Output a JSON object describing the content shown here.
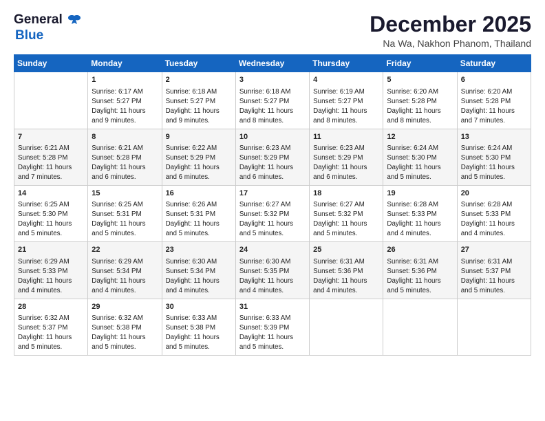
{
  "logo": {
    "line1": "General",
    "line2": "Blue"
  },
  "title": "December 2025",
  "subtitle": "Na Wa, Nakhon Phanom, Thailand",
  "days_of_week": [
    "Sunday",
    "Monday",
    "Tuesday",
    "Wednesday",
    "Thursday",
    "Friday",
    "Saturday"
  ],
  "weeks": [
    [
      {
        "day": "",
        "sunrise": "",
        "sunset": "",
        "daylight": ""
      },
      {
        "day": "1",
        "sunrise": "Sunrise: 6:17 AM",
        "sunset": "Sunset: 5:27 PM",
        "daylight": "Daylight: 11 hours and 9 minutes."
      },
      {
        "day": "2",
        "sunrise": "Sunrise: 6:18 AM",
        "sunset": "Sunset: 5:27 PM",
        "daylight": "Daylight: 11 hours and 9 minutes."
      },
      {
        "day": "3",
        "sunrise": "Sunrise: 6:18 AM",
        "sunset": "Sunset: 5:27 PM",
        "daylight": "Daylight: 11 hours and 8 minutes."
      },
      {
        "day": "4",
        "sunrise": "Sunrise: 6:19 AM",
        "sunset": "Sunset: 5:27 PM",
        "daylight": "Daylight: 11 hours and 8 minutes."
      },
      {
        "day": "5",
        "sunrise": "Sunrise: 6:20 AM",
        "sunset": "Sunset: 5:28 PM",
        "daylight": "Daylight: 11 hours and 8 minutes."
      },
      {
        "day": "6",
        "sunrise": "Sunrise: 6:20 AM",
        "sunset": "Sunset: 5:28 PM",
        "daylight": "Daylight: 11 hours and 7 minutes."
      }
    ],
    [
      {
        "day": "7",
        "sunrise": "Sunrise: 6:21 AM",
        "sunset": "Sunset: 5:28 PM",
        "daylight": "Daylight: 11 hours and 7 minutes."
      },
      {
        "day": "8",
        "sunrise": "Sunrise: 6:21 AM",
        "sunset": "Sunset: 5:28 PM",
        "daylight": "Daylight: 11 hours and 6 minutes."
      },
      {
        "day": "9",
        "sunrise": "Sunrise: 6:22 AM",
        "sunset": "Sunset: 5:29 PM",
        "daylight": "Daylight: 11 hours and 6 minutes."
      },
      {
        "day": "10",
        "sunrise": "Sunrise: 6:23 AM",
        "sunset": "Sunset: 5:29 PM",
        "daylight": "Daylight: 11 hours and 6 minutes."
      },
      {
        "day": "11",
        "sunrise": "Sunrise: 6:23 AM",
        "sunset": "Sunset: 5:29 PM",
        "daylight": "Daylight: 11 hours and 6 minutes."
      },
      {
        "day": "12",
        "sunrise": "Sunrise: 6:24 AM",
        "sunset": "Sunset: 5:30 PM",
        "daylight": "Daylight: 11 hours and 5 minutes."
      },
      {
        "day": "13",
        "sunrise": "Sunrise: 6:24 AM",
        "sunset": "Sunset: 5:30 PM",
        "daylight": "Daylight: 11 hours and 5 minutes."
      }
    ],
    [
      {
        "day": "14",
        "sunrise": "Sunrise: 6:25 AM",
        "sunset": "Sunset: 5:30 PM",
        "daylight": "Daylight: 11 hours and 5 minutes."
      },
      {
        "day": "15",
        "sunrise": "Sunrise: 6:25 AM",
        "sunset": "Sunset: 5:31 PM",
        "daylight": "Daylight: 11 hours and 5 minutes."
      },
      {
        "day": "16",
        "sunrise": "Sunrise: 6:26 AM",
        "sunset": "Sunset: 5:31 PM",
        "daylight": "Daylight: 11 hours and 5 minutes."
      },
      {
        "day": "17",
        "sunrise": "Sunrise: 6:27 AM",
        "sunset": "Sunset: 5:32 PM",
        "daylight": "Daylight: 11 hours and 5 minutes."
      },
      {
        "day": "18",
        "sunrise": "Sunrise: 6:27 AM",
        "sunset": "Sunset: 5:32 PM",
        "daylight": "Daylight: 11 hours and 5 minutes."
      },
      {
        "day": "19",
        "sunrise": "Sunrise: 6:28 AM",
        "sunset": "Sunset: 5:33 PM",
        "daylight": "Daylight: 11 hours and 4 minutes."
      },
      {
        "day": "20",
        "sunrise": "Sunrise: 6:28 AM",
        "sunset": "Sunset: 5:33 PM",
        "daylight": "Daylight: 11 hours and 4 minutes."
      }
    ],
    [
      {
        "day": "21",
        "sunrise": "Sunrise: 6:29 AM",
        "sunset": "Sunset: 5:33 PM",
        "daylight": "Daylight: 11 hours and 4 minutes."
      },
      {
        "day": "22",
        "sunrise": "Sunrise: 6:29 AM",
        "sunset": "Sunset: 5:34 PM",
        "daylight": "Daylight: 11 hours and 4 minutes."
      },
      {
        "day": "23",
        "sunrise": "Sunrise: 6:30 AM",
        "sunset": "Sunset: 5:34 PM",
        "daylight": "Daylight: 11 hours and 4 minutes."
      },
      {
        "day": "24",
        "sunrise": "Sunrise: 6:30 AM",
        "sunset": "Sunset: 5:35 PM",
        "daylight": "Daylight: 11 hours and 4 minutes."
      },
      {
        "day": "25",
        "sunrise": "Sunrise: 6:31 AM",
        "sunset": "Sunset: 5:36 PM",
        "daylight": "Daylight: 11 hours and 4 minutes."
      },
      {
        "day": "26",
        "sunrise": "Sunrise: 6:31 AM",
        "sunset": "Sunset: 5:36 PM",
        "daylight": "Daylight: 11 hours and 5 minutes."
      },
      {
        "day": "27",
        "sunrise": "Sunrise: 6:31 AM",
        "sunset": "Sunset: 5:37 PM",
        "daylight": "Daylight: 11 hours and 5 minutes."
      }
    ],
    [
      {
        "day": "28",
        "sunrise": "Sunrise: 6:32 AM",
        "sunset": "Sunset: 5:37 PM",
        "daylight": "Daylight: 11 hours and 5 minutes."
      },
      {
        "day": "29",
        "sunrise": "Sunrise: 6:32 AM",
        "sunset": "Sunset: 5:38 PM",
        "daylight": "Daylight: 11 hours and 5 minutes."
      },
      {
        "day": "30",
        "sunrise": "Sunrise: 6:33 AM",
        "sunset": "Sunset: 5:38 PM",
        "daylight": "Daylight: 11 hours and 5 minutes."
      },
      {
        "day": "31",
        "sunrise": "Sunrise: 6:33 AM",
        "sunset": "Sunset: 5:39 PM",
        "daylight": "Daylight: 11 hours and 5 minutes."
      },
      {
        "day": "",
        "sunrise": "",
        "sunset": "",
        "daylight": ""
      },
      {
        "day": "",
        "sunrise": "",
        "sunset": "",
        "daylight": ""
      },
      {
        "day": "",
        "sunrise": "",
        "sunset": "",
        "daylight": ""
      }
    ]
  ]
}
